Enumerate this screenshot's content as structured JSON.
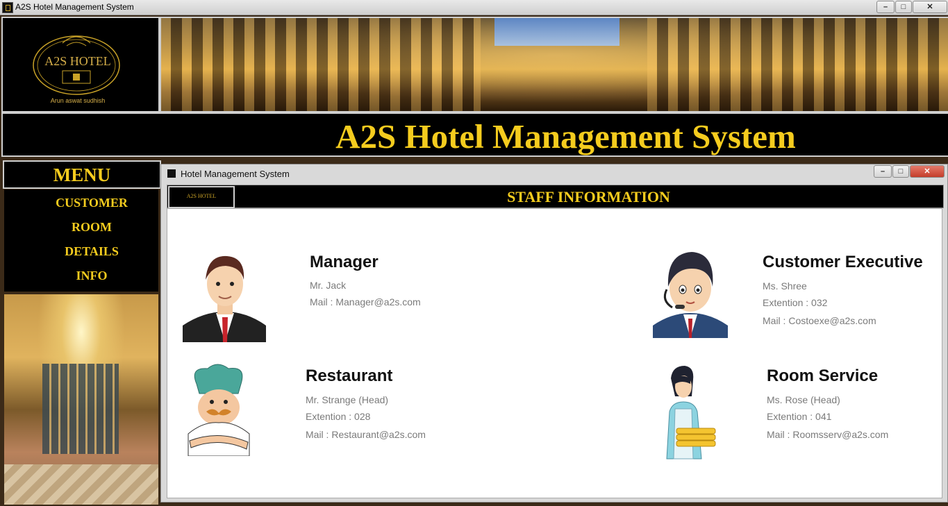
{
  "window": {
    "title": "A2S Hotel Management System",
    "controls": [
      "–",
      "□",
      "✕"
    ]
  },
  "logo": {
    "name": "A2S HOTEL",
    "tagline": "Arun aswat sudhish"
  },
  "banner_title": "A2S Hotel Management System",
  "menu": {
    "heading": "MENU",
    "items": [
      "CUSTOMER",
      "ROOM",
      "DETAILS",
      "INFO"
    ]
  },
  "inner_window": {
    "title": "Hotel Management System",
    "mini_logo": "A2S HOTEL",
    "section_title": "STAFF INFORMATION"
  },
  "staff": [
    {
      "role": "Manager",
      "name": "Mr. Jack",
      "extension": "",
      "mail": "Mail : Manager@a2s.com",
      "icon": "manager-avatar-icon"
    },
    {
      "role": "Customer Executive",
      "name": "Ms. Shree",
      "extension": "Extention : 032",
      "mail": "Mail : Costoexe@a2s.com",
      "icon": "customer-executive-avatar-icon"
    },
    {
      "role": "Restaurant",
      "name": "Mr. Strange (Head)",
      "extension": "Extention : 028",
      "mail": "Mail : Restaurant@a2s.com",
      "icon": "chef-avatar-icon"
    },
    {
      "role": "Room Service",
      "name": "Ms. Rose (Head)",
      "extension": "Extention : 041",
      "mail": "Mail : Roomsserv@a2s.com",
      "icon": "room-service-avatar-icon"
    }
  ],
  "colors": {
    "accent_gold": "#f5cc1e",
    "panel_bg": "#000000",
    "content_bg": "#ffffff"
  }
}
